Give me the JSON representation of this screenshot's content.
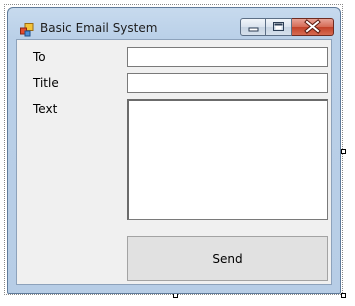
{
  "window": {
    "title": "Basic Email System",
    "icon": "form-icon"
  },
  "caption_buttons": {
    "minimize_icon": "minimize-icon",
    "maximize_icon": "maximize-icon",
    "close_icon": "close-icon"
  },
  "form": {
    "to_label": "To",
    "to_value": "",
    "title_label": "Title",
    "title_value": "",
    "text_label": "Text",
    "text_value": "",
    "send_label": "Send"
  },
  "colors": {
    "client_background": "#f0f0f0",
    "button_background": "#e1e1e1",
    "close_button": "#c24128"
  }
}
